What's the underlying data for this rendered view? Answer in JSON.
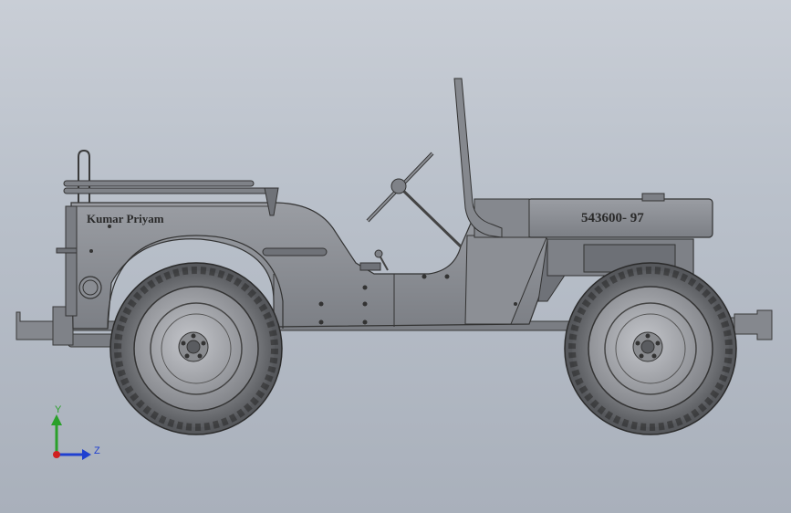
{
  "model": {
    "side_text": "Kumar Priyam",
    "hood_text": "543600- 97"
  },
  "triad": {
    "y_label": "Y",
    "z_label": "Z",
    "colors": {
      "y": "#2aa02a",
      "z": "#2040d0",
      "x": "#d02020"
    }
  },
  "colors": {
    "body": "#8a8d93",
    "body_dark": "#5c5f64",
    "tire": "#6a6c70",
    "rim": "#9b9ea4"
  }
}
